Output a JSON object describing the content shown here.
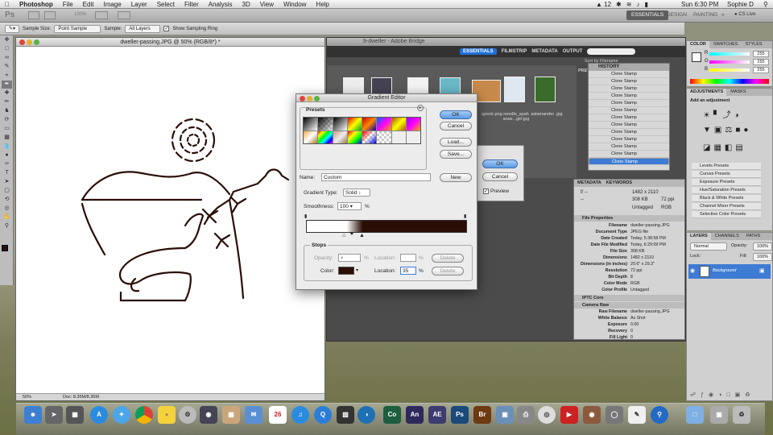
{
  "menubar": {
    "apple": "",
    "app": "Photoshop",
    "items": [
      "File",
      "Edit",
      "Image",
      "Layer",
      "Select",
      "Filter",
      "Analysis",
      "3D",
      "View",
      "Window",
      "Help"
    ],
    "status_num": "12",
    "clock": "Sun 6:30 PM",
    "user": "Sophie D"
  },
  "appbar": {
    "ps_logo": "Ps",
    "zoom": "100%",
    "workspaces": [
      "ESSENTIALS",
      "DESIGN",
      "PAINTING"
    ],
    "more": "»",
    "cslive": "CS Live"
  },
  "options": {
    "sample_size_label": "Sample Size:",
    "sample_size": "Point Sample",
    "sample_label": "Sample:",
    "sample": "All Layers",
    "ring_label": "Show Sampling Ring"
  },
  "document": {
    "title": "dweller-passing.JPG @ 50% (RGB/8*) *",
    "zoom": "50%",
    "doc_size": "Doc: 8.35M/8.35M"
  },
  "bridge": {
    "title": "9-dweller - Adobe Bridge",
    "tabs": [
      "ESSENTIALS",
      "FILMSTRIP",
      "METADATA",
      "OUTPUT"
    ],
    "sort": "Sort by Filename",
    "prev_label": "PREV",
    "thumbs": [
      {
        "label": ""
      },
      {
        "label": ""
      },
      {
        "label": ""
      },
      {
        "label": ""
      },
      {
        "label": ""
      },
      {
        "label": ""
      },
      {
        "label": ""
      }
    ],
    "thumb_labels": [
      "igrock\npng",
      "needle_spah\nanse...girl.jpg",
      "salamander\n.jpg"
    ]
  },
  "history": {
    "title": "HISTORY",
    "items": [
      "Clone Stamp",
      "Clone Stamp",
      "Clone Stamp",
      "Clone Stamp",
      "Clone Stamp",
      "Clone Stamp",
      "Clone Stamp",
      "Clone Stamp",
      "Clone Stamp",
      "Clone Stamp",
      "Clone Stamp",
      "Clone Stamp",
      "Clone Stamp"
    ],
    "selected_index": 12
  },
  "metadata": {
    "tabs": [
      "METADATA",
      "KEYWORDS"
    ],
    "summary": {
      "fstop": "f/ --",
      "exposure": "--",
      "dims": "1482 x 2110",
      "size": "308 KB",
      "ppi": "72 ppi",
      "tag": "Untagged",
      "mode": "RGB"
    },
    "file_properties_title": "File Properties",
    "rows": [
      [
        "Filename",
        "dweller-passing.JPG"
      ],
      [
        "Document Type",
        "JPEG file"
      ],
      [
        "Date Created",
        "Today, 5:38:58 PM"
      ],
      [
        "Date File Modified",
        "Today, 6:29:09 PM"
      ],
      [
        "File Size",
        "308 KB"
      ],
      [
        "Dimensions",
        "1482 x 2110"
      ],
      [
        "Dimensions (in inches)",
        "20.6\" x 29.3\""
      ],
      [
        "Resolution",
        "72 ppi"
      ],
      [
        "Bit Depth",
        "8"
      ],
      [
        "Color Mode",
        "RGB"
      ],
      [
        "Color Profile",
        "Untagged"
      ]
    ],
    "iptc_title": "IPTC Core",
    "camera_title": "Camera Raw",
    "camera_rows": [
      [
        "Raw Filename",
        "dweller-passing.JPG"
      ],
      [
        "White Balance",
        "As Shot"
      ],
      [
        "Exposure",
        "0.00"
      ],
      [
        "Recovery",
        "0"
      ],
      [
        "Fill Light",
        "0"
      ]
    ]
  },
  "color_panel": {
    "tabs": [
      "COLOR",
      "SWATCHES",
      "STYLES"
    ],
    "r": "255",
    "g": "255",
    "b": "255",
    "r_label": "R",
    "g_label": "G",
    "b_label": "B"
  },
  "adjustments": {
    "tabs": [
      "ADJUSTMENTS",
      "MASKS"
    ],
    "heading": "Add an adjustment",
    "presets": [
      "Levels Presets",
      "Curves Presets",
      "Exposure Presets",
      "Hue/Saturation Presets",
      "Black & White Presets",
      "Channel Mixer Presets",
      "Selective Color Presets"
    ]
  },
  "layers": {
    "tabs": [
      "LAYERS",
      "CHANNELS",
      "PATHS"
    ],
    "blend": "Normal",
    "opacity_label": "Opacity:",
    "opacity": "100%",
    "lock_label": "Lock:",
    "fill_label": "Fill:",
    "fill": "100%",
    "layer_name": "Background"
  },
  "dialog2": {
    "ok": "OK",
    "cancel": "Cancel",
    "preview": "Preview"
  },
  "gradient_editor": {
    "title": "Gradient Editor",
    "presets_label": "Presets",
    "ok": "OK",
    "cancel": "Cancel",
    "load": "Load...",
    "save": "Save...",
    "name_label": "Name:",
    "name_value": "Custom",
    "new": "New",
    "type_label": "Gradient Type:",
    "type_value": "Solid",
    "smoothness_label": "Smoothness:",
    "smoothness_value": "100",
    "percent": "%",
    "stops_label": "Stops",
    "opacity_label": "Opacity:",
    "location_label": "Location:",
    "delete": "Delete",
    "color_label": "Color:",
    "color_location": "35",
    "stop_color": "#2a0e06"
  },
  "dock": {
    "apps": [
      "Finder",
      "Launchpad",
      "Mission",
      "App Store",
      "Safari",
      "Chrome",
      "Cyberduck",
      "Utility",
      "Camera",
      "Preview",
      "Mail",
      "iCal",
      "iTunes",
      "Spotlight",
      "Clapper",
      "Firefox",
      "Co",
      "An",
      "AE",
      "Ps",
      "Br",
      "Photos",
      "Printer",
      "Aperture",
      "FaceTime",
      "Photo Booth",
      "Security",
      "TextEdit",
      "Maps",
      "Folder",
      "Drive",
      "Trash"
    ]
  }
}
